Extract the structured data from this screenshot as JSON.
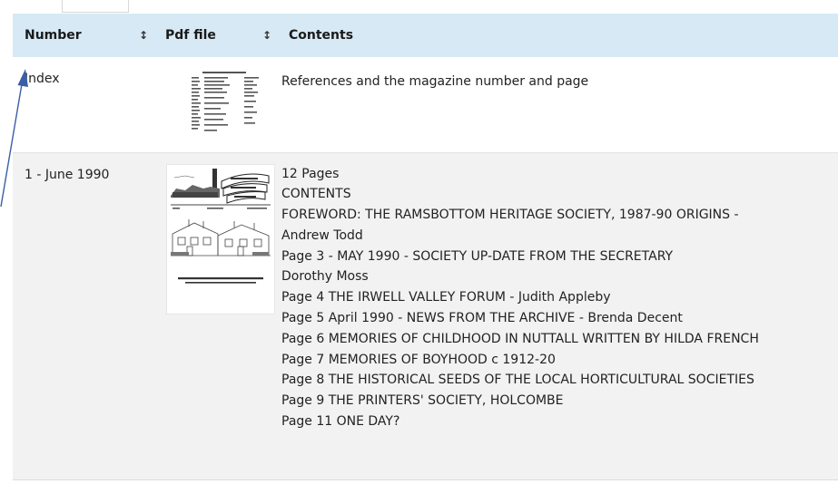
{
  "table": {
    "headers": [
      {
        "label": "Number"
      },
      {
        "label": "Pdf file"
      },
      {
        "label": "Contents"
      }
    ],
    "sort_icon": "↕",
    "rows": [
      {
        "number": "Index",
        "thumbnail_icon": "index-document-thumbnail",
        "contents": [
          "References and the magazine number and page"
        ]
      },
      {
        "number": "1 - June 1990",
        "thumbnail_icon": "newsletter-cover-thumbnail",
        "contents": [
          "12 Pages",
          "CONTENTS",
          "FOREWORD: THE RAMSBOTTOM HERITAGE SOCIETY, 1987-90 ORIGINS -",
          "Andrew Todd",
          "Page 3 - MAY 1990 - SOCIETY UP-DATE FROM THE SECRETARY",
          "Dorothy Moss",
          "Page 4 THE IRWELL VALLEY FORUM - Judith Appleby",
          "Page 5 April 1990 - NEWS FROM THE ARCHIVE - Brenda Decent",
          "Page 6 MEMORIES OF CHILDHOOD IN NUTTALL WRITTEN BY HILDA FRENCH",
          "Page 7 MEMORIES OF BOYHOOD c 1912-20",
          "Page 8 THE HISTORICAL SEEDS OF THE LOCAL HORTICULTURAL SOCIETIES",
          "Page 9 THE PRINTERS' SOCIETY, HOLCOMBE",
          "Page 11 ONE DAY?"
        ]
      }
    ]
  },
  "colors": {
    "header_bg": "#d7e9f5",
    "row_alt_bg": "#f2f2f2",
    "arrow": "#3b5ea8"
  }
}
